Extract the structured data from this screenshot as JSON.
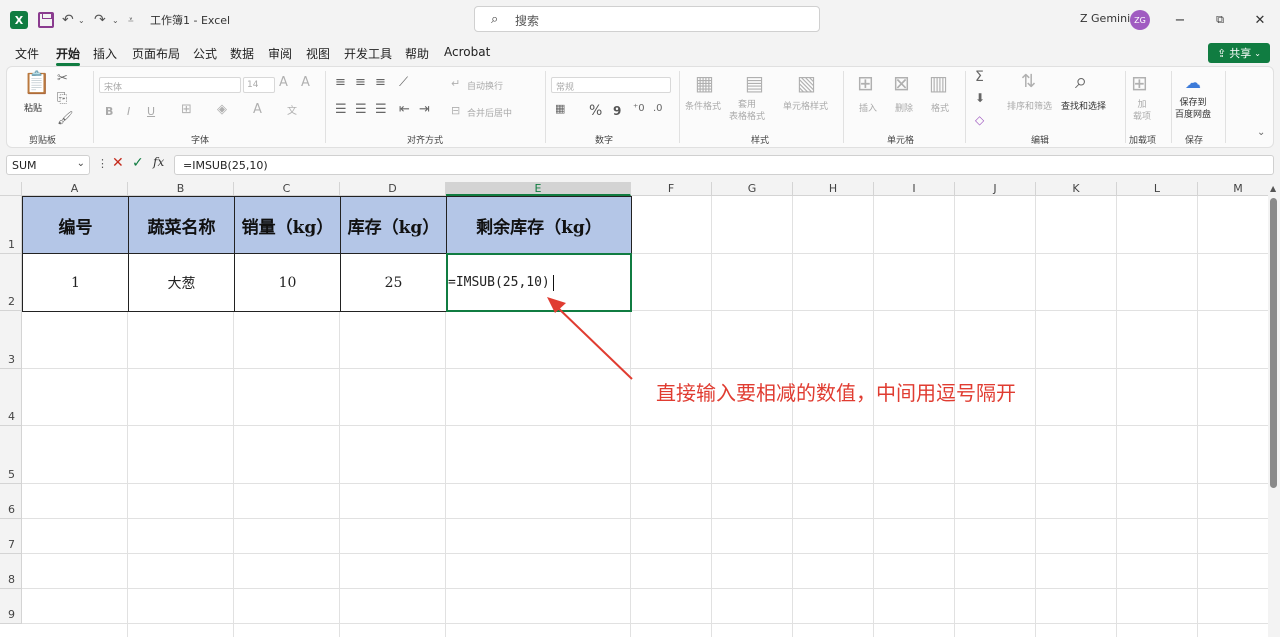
{
  "window": {
    "title": "工作簿1 - Excel",
    "search_placeholder": "搜索",
    "user_name": "Z Gemini",
    "user_initials": "ZG",
    "minimize": "−",
    "restore": "⧉",
    "close": "✕"
  },
  "menu": {
    "tabs": [
      "文件",
      "开始",
      "插入",
      "页面布局",
      "公式",
      "数据",
      "审阅",
      "视图",
      "开发工具",
      "帮助",
      "Acrobat"
    ],
    "active": "开始",
    "share_label": "共享"
  },
  "ribbon": {
    "clipboard": {
      "paste": "粘贴",
      "group": "剪贴板"
    },
    "font": {
      "font_name": "宋体",
      "font_size": "14",
      "bold": "B",
      "italic": "I",
      "underline": "U",
      "group": "字体"
    },
    "alignment": {
      "wrap": "自动换行",
      "merge": "合并后居中",
      "group": "对齐方式"
    },
    "number": {
      "format": "常规",
      "percent": "%",
      "comma": "9",
      "group": "数字"
    },
    "styles": {
      "conditional": "条件格式",
      "table": "套用\n表格格式",
      "cell_styles": "单元格样式",
      "group": "样式"
    },
    "cells": {
      "insert": "插入",
      "delete": "删除",
      "format": "格式",
      "group": "单元格"
    },
    "editing": {
      "sort_filter": "排序和筛选",
      "find_select": "查找和选择",
      "group": "编辑"
    },
    "addins": {
      "addins": "加\n载项",
      "group": "加载项"
    },
    "save": {
      "save_to": "保存到\n百度网盘",
      "group": "保存"
    }
  },
  "formula_bar": {
    "name_box": "SUM",
    "formula": "=IMSUB(25,10)",
    "fx": "fx"
  },
  "grid": {
    "columns": [
      "A",
      "B",
      "C",
      "D",
      "E",
      "F",
      "G",
      "H",
      "I",
      "J",
      "K",
      "L",
      "M"
    ],
    "selected_column": "E",
    "rows": [
      "1",
      "2",
      "3",
      "4",
      "5",
      "6",
      "7",
      "8",
      "9"
    ],
    "header_row": [
      "编号",
      "蔬菜名称",
      "销量（kg）",
      "库存（kg）",
      "剩余库存（kg）"
    ],
    "data_row": [
      "1",
      "大葱",
      "10",
      "25",
      "=IMSUB(25,10)"
    ],
    "header_fill": "#b4c6e7"
  },
  "annotation": {
    "text": "直接输入要相减的数值，中间用逗号隔开",
    "color": "#e03c31"
  }
}
